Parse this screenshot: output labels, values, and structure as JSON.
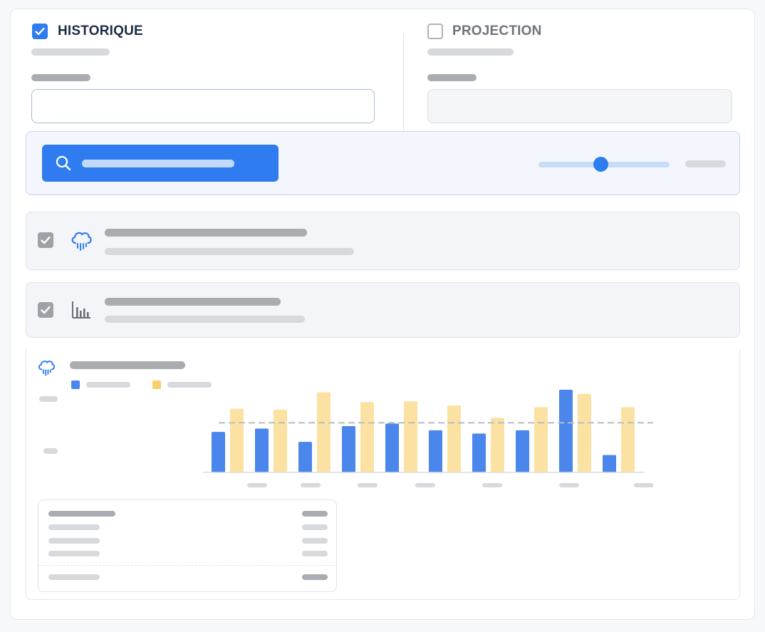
{
  "modes": {
    "historique": {
      "label": "HISTORIQUE",
      "checked": true
    },
    "projection": {
      "label": "PROJECTION",
      "checked": false
    }
  },
  "inputs": {
    "historique_value": "",
    "projection_value": ""
  },
  "search": {
    "slider_fraction": 0.48
  },
  "layers": [
    {
      "icon": "cloud-rain-icon",
      "checked": true
    },
    {
      "icon": "bar-chart-icon",
      "checked": true
    }
  ],
  "colors": {
    "accent": "#2f7cf0",
    "series_a": "#4a86ec",
    "series_b": "#fbe2a2",
    "reference_line": "#b8bcc2",
    "title_text": "#1c2b45",
    "muted_text": "#6f747b"
  },
  "chart_data": {
    "type": "bar",
    "series": [
      {
        "values": [
          0.49,
          0.53,
          0.37,
          0.56,
          0.59,
          0.51,
          0.47,
          0.51,
          1.0,
          0.21
        ]
      },
      {
        "values": [
          0.77,
          0.76,
          0.97,
          0.85,
          0.86,
          0.81,
          0.66,
          0.79,
          0.95,
          0.79
        ]
      }
    ],
    "reference_line": 0.6,
    "ylim": [
      0,
      1
    ],
    "legend": "top-left",
    "grid": false
  }
}
